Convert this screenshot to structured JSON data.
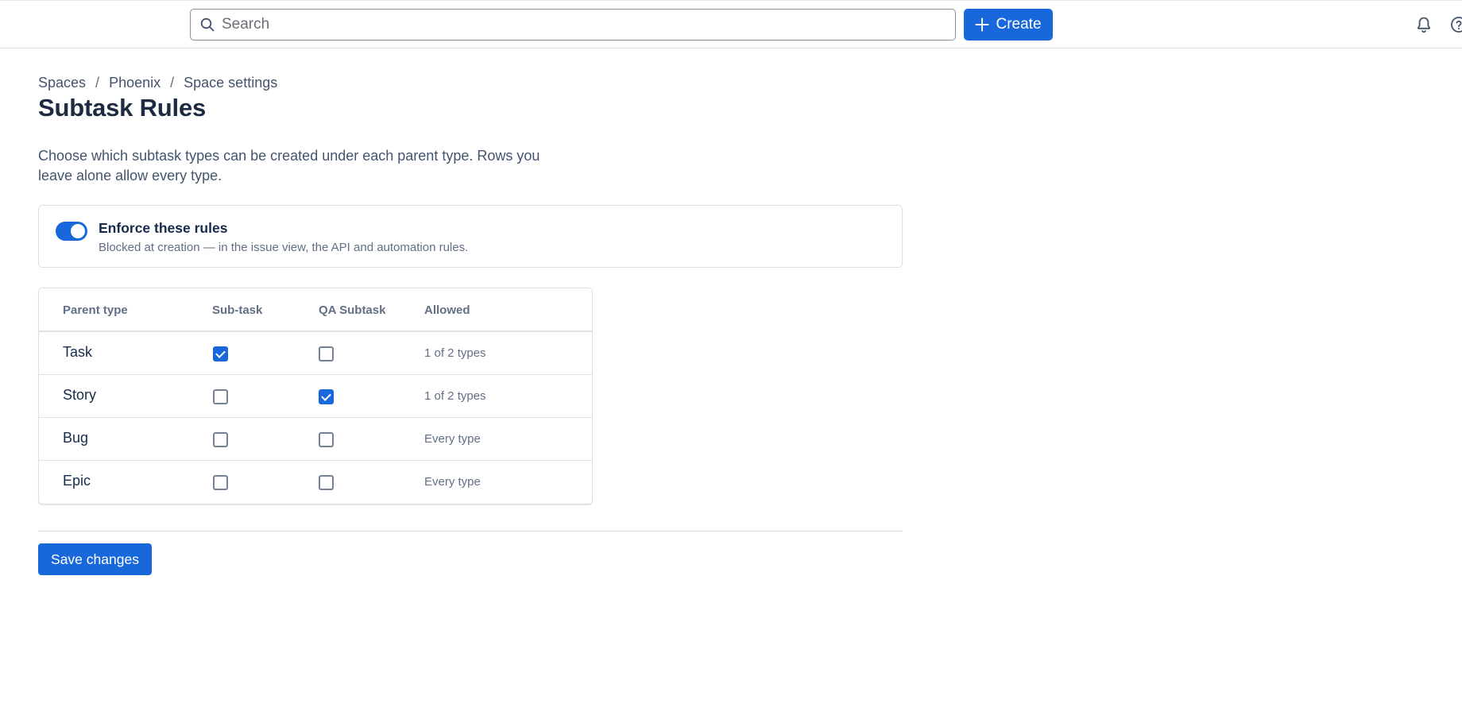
{
  "search": {
    "placeholder": "Search"
  },
  "create": {
    "label": "Create"
  },
  "breadcrumb": [
    "Spaces",
    "Phoenix",
    "Space settings"
  ],
  "page": {
    "title": "Subtask Rules",
    "description": "Choose which subtask types can be created under each parent type. Rows you leave alone allow every type."
  },
  "enforce": {
    "enabled": true,
    "title": "Enforce these rules",
    "subtitle": "Blocked at creation — in the issue view, the API and automation rules."
  },
  "table": {
    "headers": [
      "Parent type",
      "Sub-task",
      "QA Subtask",
      "Allowed"
    ],
    "rows": [
      {
        "parent": "Task",
        "subtask": true,
        "qa_subtask": false,
        "allowed": "1 of 2 types"
      },
      {
        "parent": "Story",
        "subtask": false,
        "qa_subtask": true,
        "allowed": "1 of 2 types"
      },
      {
        "parent": "Bug",
        "subtask": false,
        "qa_subtask": false,
        "allowed": "Every type"
      },
      {
        "parent": "Epic",
        "subtask": false,
        "qa_subtask": false,
        "allowed": "Every type"
      }
    ]
  },
  "save": {
    "label": "Save changes"
  },
  "icons": {
    "search": "search-icon",
    "plus": "plus-icon",
    "bell": "bell-icon",
    "help": "help-icon"
  },
  "colors": {
    "accent": "#1868db"
  }
}
